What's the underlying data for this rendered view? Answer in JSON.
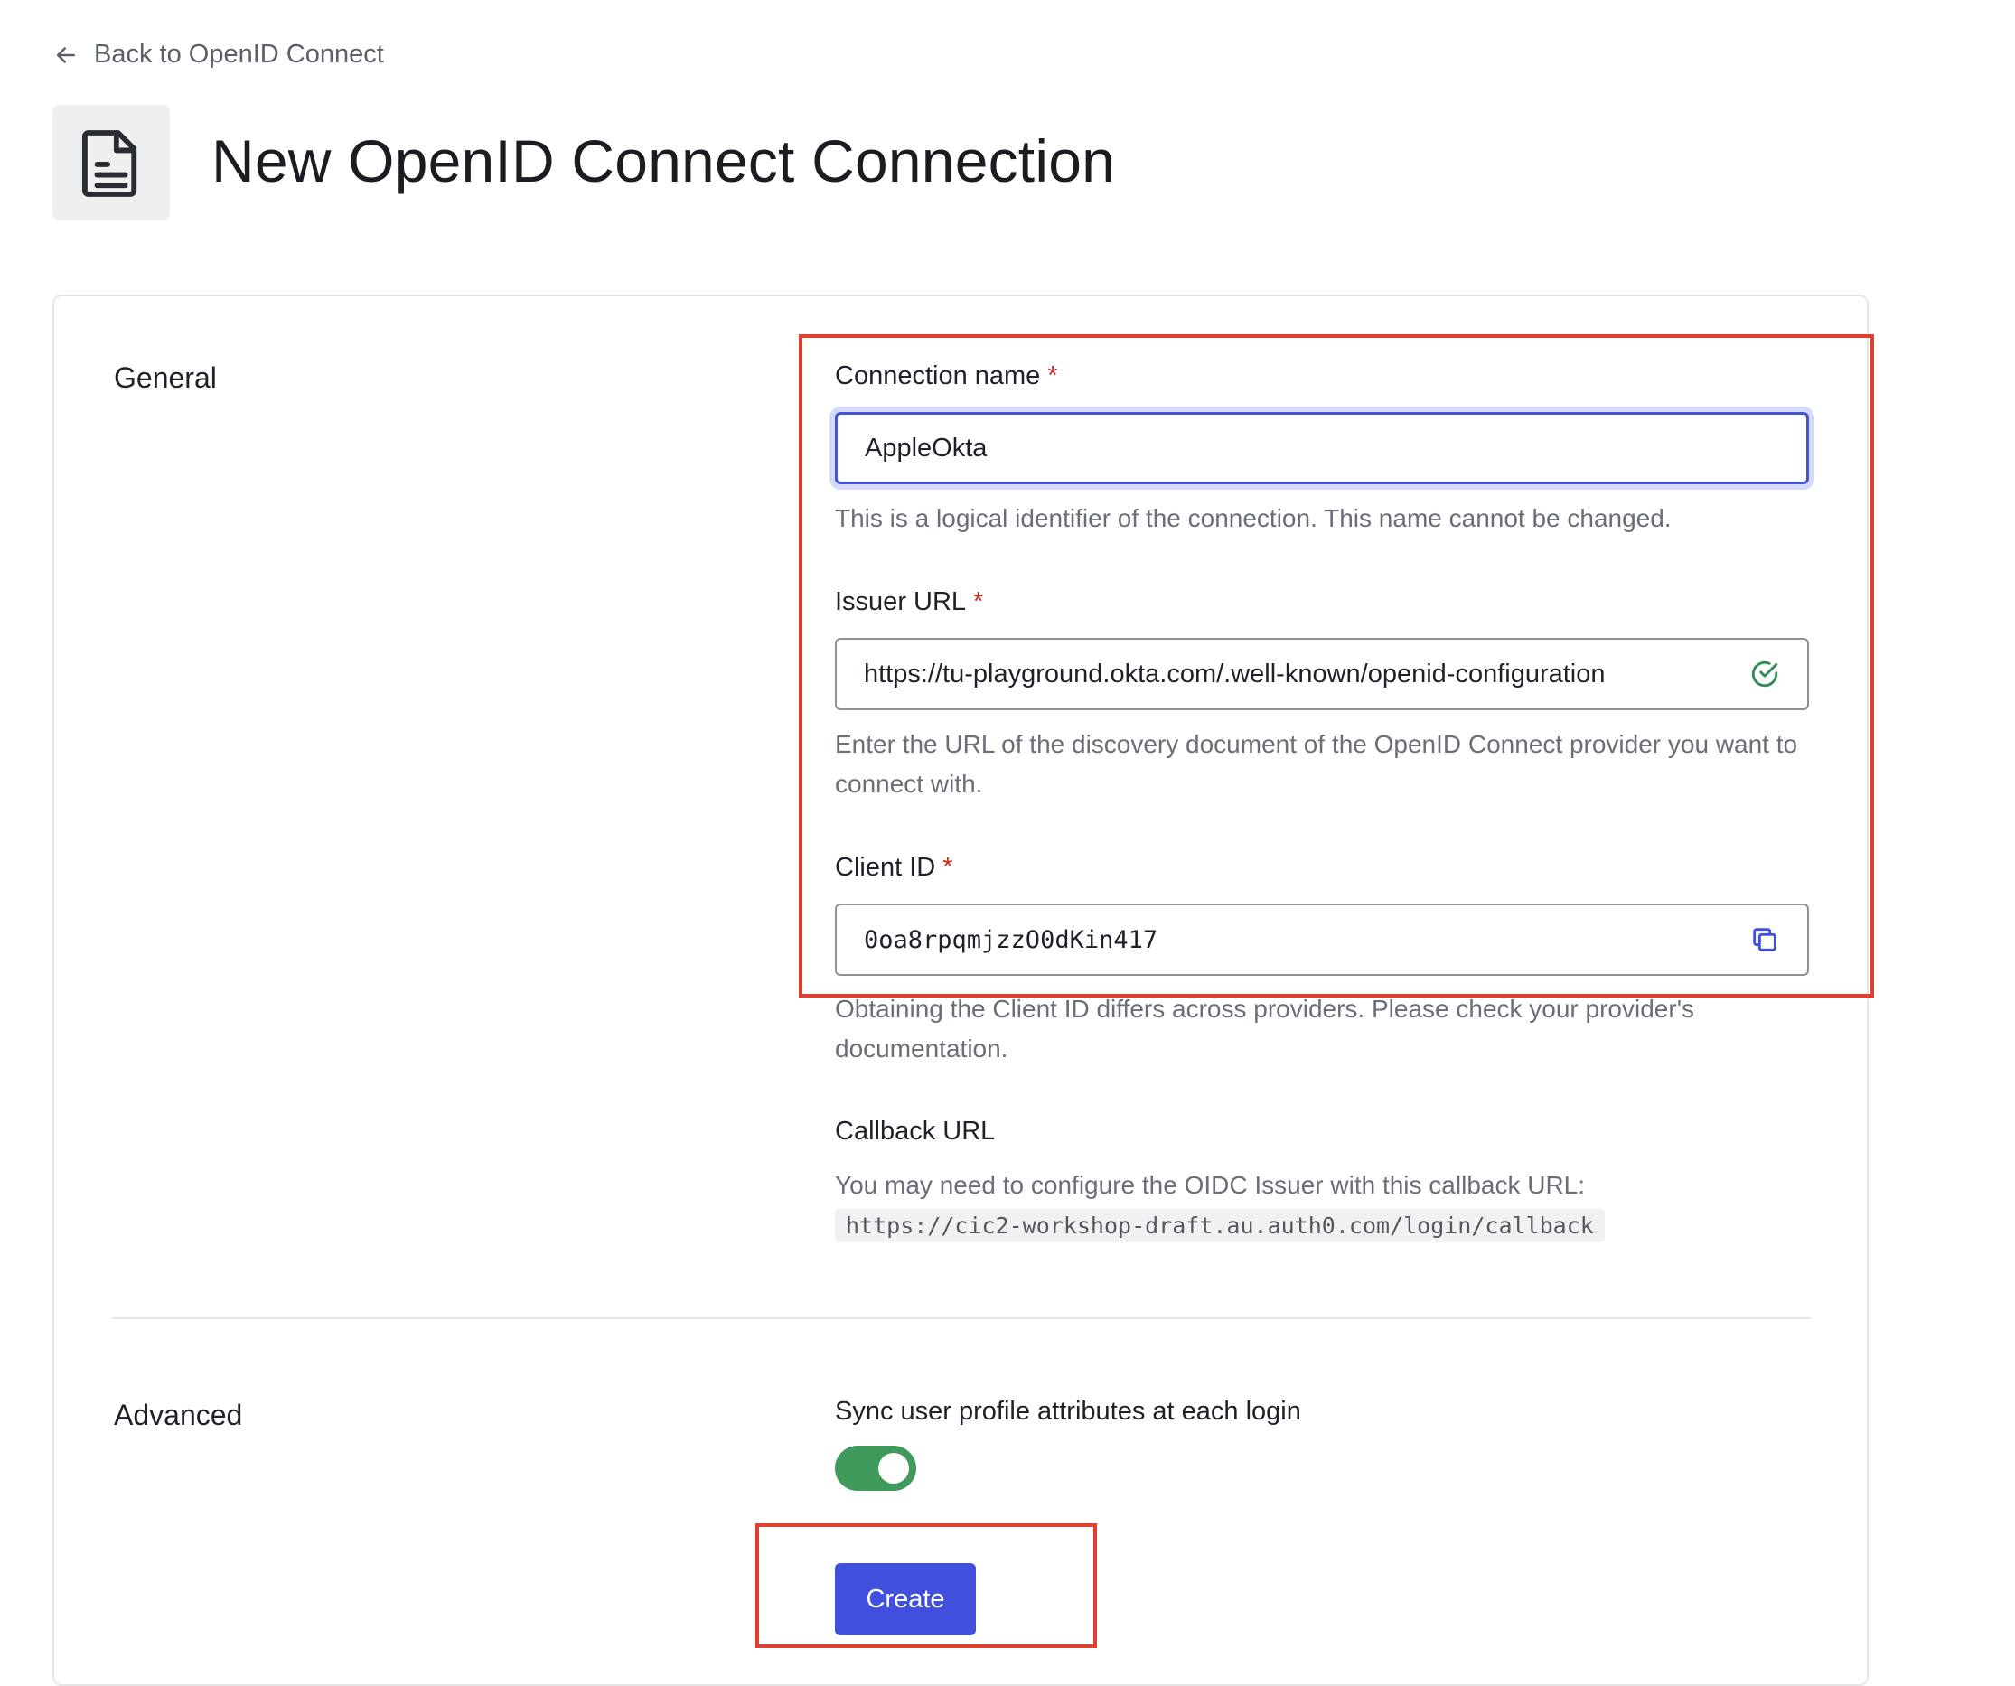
{
  "nav": {
    "back_label": "Back to OpenID Connect"
  },
  "header": {
    "title": "New OpenID Connect Connection"
  },
  "general": {
    "section_label": "General",
    "connection_name": {
      "label": "Connection name",
      "required_marker": "*",
      "value": "AppleOkta",
      "help": "This is a logical identifier of the connection. This name cannot be changed."
    },
    "issuer_url": {
      "label": "Issuer URL",
      "required_marker": "*",
      "value": "https://tu-playground.okta.com/.well-known/openid-configuration",
      "help": "Enter the URL of the discovery document of the OpenID Connect provider you want to connect with.",
      "status_icon": "check-circle-icon"
    },
    "client_id": {
      "label": "Client ID",
      "required_marker": "*",
      "value": "0oa8rpqmjzzO0dKin417",
      "help": "Obtaining the Client ID differs across providers. Please check your provider's documentation.",
      "action_icon": "copy-icon"
    },
    "callback": {
      "label": "Callback URL",
      "help": "You may need to configure the OIDC Issuer with this callback URL:",
      "url": "https://cic2-workshop-draft.au.auth0.com/login/callback"
    }
  },
  "advanced": {
    "section_label": "Advanced",
    "sync_label": "Sync user profile attributes at each login",
    "sync_enabled": true
  },
  "actions": {
    "create_label": "Create"
  },
  "colors": {
    "accent": "#4150dc",
    "focus_border": "#4355d5",
    "toggle_on": "#3f9a5c",
    "required": "#c4271f",
    "highlight_box": "#e0402f"
  }
}
